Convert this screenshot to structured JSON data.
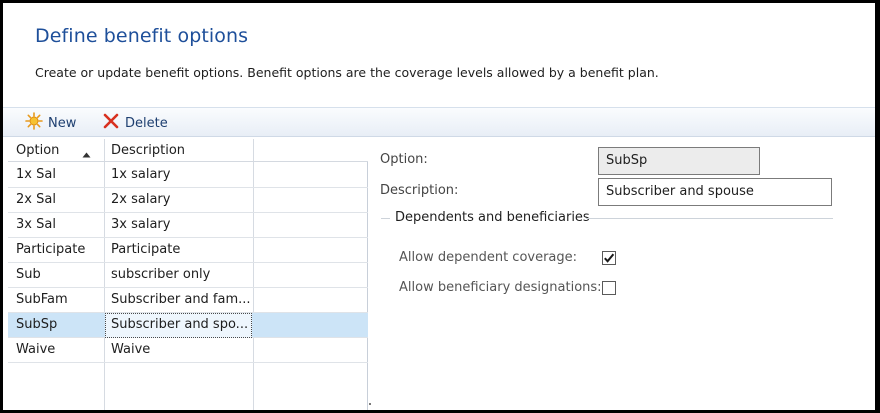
{
  "header": {
    "title": "Define benefit options",
    "subtitle": "Create or update benefit options. Benefit options are the coverage levels allowed by a benefit plan."
  },
  "toolbar": {
    "new_label": "New",
    "delete_label": "Delete"
  },
  "grid": {
    "columns": [
      "Option",
      "Description"
    ],
    "sort": "ascending",
    "rows": [
      {
        "option": "1x Sal",
        "description": "1x salary"
      },
      {
        "option": "2x Sal",
        "description": "2x salary"
      },
      {
        "option": "3x Sal",
        "description": "3x salary"
      },
      {
        "option": "Participate",
        "description": "Participate"
      },
      {
        "option": "Sub",
        "description": "subscriber only"
      },
      {
        "option": "SubFam",
        "description": "Subscriber and fam..."
      },
      {
        "option": "SubSp",
        "description": "Subscriber and spo..."
      },
      {
        "option": "Waive",
        "description": "Waive"
      }
    ],
    "selected_index": 6
  },
  "details": {
    "option_label": "Option:",
    "option_value": "SubSp",
    "description_label": "Description:",
    "description_value": "Subscriber and spouse",
    "group_title": "Dependents and beneficiaries",
    "allow_dependent_label": "Allow dependent coverage:",
    "allow_dependent_checked": true,
    "allow_beneficiary_label": "Allow beneficiary designations:",
    "allow_beneficiary_checked": false
  },
  "colors": {
    "title": "#1e4f9a",
    "selection": "#cce4f7",
    "toolbar_text": "#1e3f70"
  }
}
